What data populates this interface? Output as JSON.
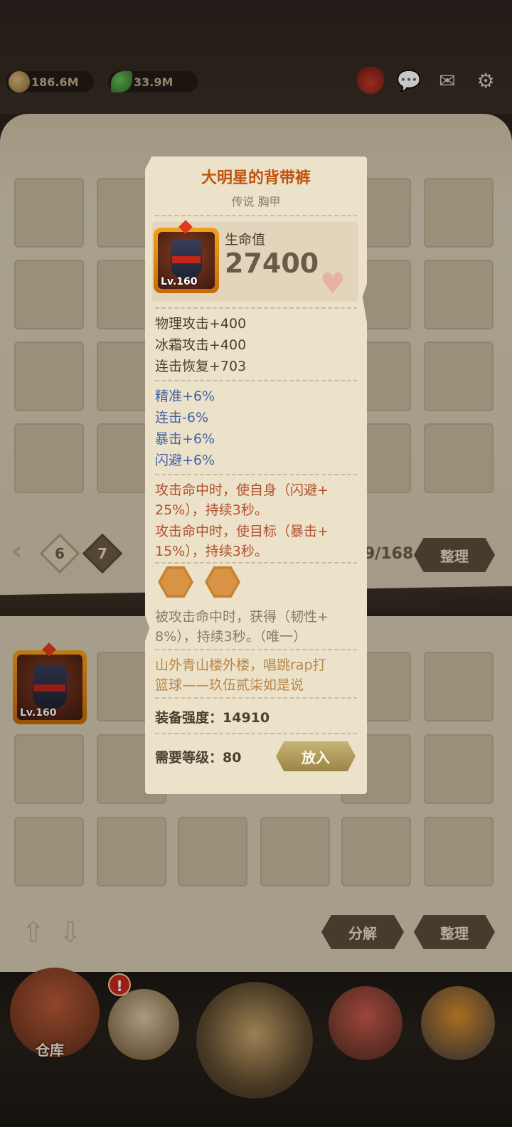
{
  "currencies": [
    {
      "name": "coin-icon",
      "value": "186.6M"
    },
    {
      "name": "leaf-icon",
      "value": "33.9M"
    }
  ],
  "pagination": {
    "pages": [
      "6",
      "7"
    ],
    "active": "7",
    "count": "9/168"
  },
  "buttons": {
    "sort_top": "整理",
    "decompose": "分解",
    "sort_bottom": "整理"
  },
  "equipped_item": {
    "level": "Lv.160"
  },
  "bottom_nav": {
    "warehouse_label": "仓库",
    "alert": "!"
  },
  "item": {
    "name": "大明星的背带裤",
    "subtitle": "传说 胸甲",
    "level": "Lv.160",
    "main_stat_label": "生命值",
    "main_stat_value": "27400",
    "base_stats": [
      "物理攻击+400",
      "冰霜攻击+400",
      "连击恢复+703"
    ],
    "bonus_stats": [
      "精准+6%",
      "连击-6%",
      "暴击+6%",
      "闪避+6%"
    ],
    "effects": [
      "攻击命中时，使自身（闪避+",
      "25%），持续3秒。",
      "攻击命中时，使目标（暴击+",
      "15%），持续3秒。"
    ],
    "passive": [
      "被攻击命中时，获得（韧性+",
      "8%），持续3秒。（唯一）"
    ],
    "flavor": [
      "山外青山楼外楼，唱跳rap打",
      "篮球——玖伍贰柒如是说"
    ],
    "strength": "装备强度：14910",
    "required_level": "需要等级：80",
    "place_button": "放入"
  },
  "colors": {
    "title": "#c2530f",
    "bonus": "#4462a8",
    "effect": "#b2502f",
    "legendary_frame": "#f4a018"
  }
}
